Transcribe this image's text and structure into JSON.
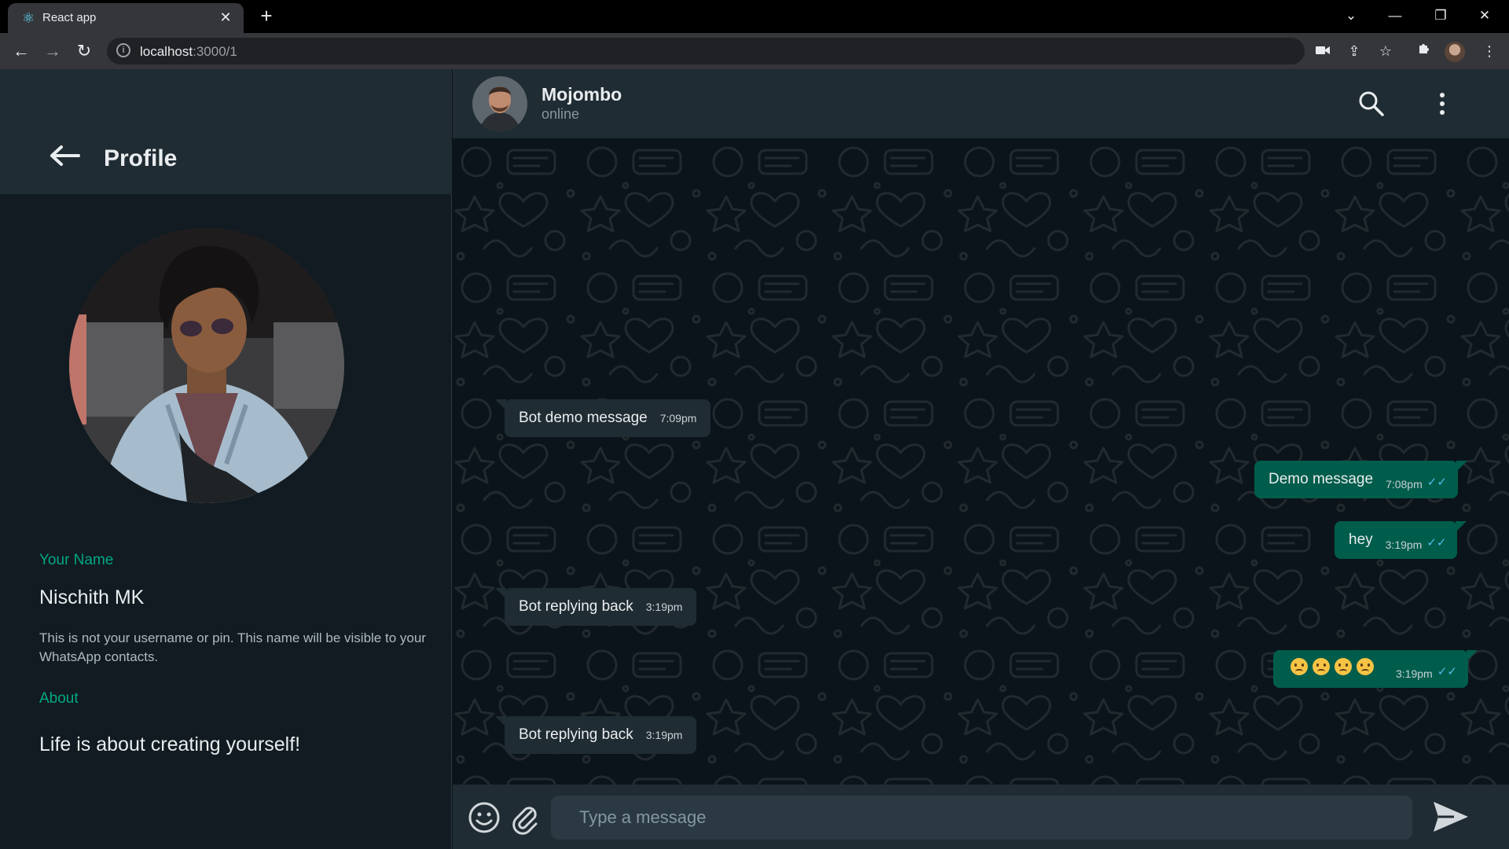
{
  "browser": {
    "tab_title": "React app",
    "url_host": "localhost",
    "url_path": ":3000/1"
  },
  "profile": {
    "title": "Profile",
    "name_label": "Your Name",
    "name_value": "Nischith MK",
    "name_hint": "This is not your username or pin. This name will be visible to your WhatsApp contacts.",
    "about_label": "About",
    "about_value": "Life is about creating yourself!"
  },
  "chat": {
    "contact_name": "Mojombo",
    "contact_status": "online",
    "input_placeholder": "Type a message",
    "messages": [
      {
        "direction": "incoming",
        "text": "Bot demo message",
        "time": "7:09pm"
      },
      {
        "direction": "outgoing",
        "text": "Demo message",
        "time": "7:08pm",
        "ticks": "✓✓"
      },
      {
        "direction": "outgoing",
        "text": "hey",
        "time": "3:19pm",
        "ticks": "✓✓"
      },
      {
        "direction": "incoming",
        "text": "Bot replying back",
        "time": "3:19pm"
      },
      {
        "direction": "outgoing",
        "text": "",
        "emoji_count": 4,
        "time": "3:19pm",
        "ticks": "✓✓"
      },
      {
        "direction": "incoming",
        "text": "Bot replying back",
        "time": "3:19pm"
      }
    ]
  },
  "colors": {
    "accent_green": "#00a884",
    "outgoing_bubble": "#005c4b",
    "incoming_bubble": "#202c33",
    "panel_bg": "#111b21",
    "header_bg": "#202c33",
    "read_ticks": "#53bdeb"
  },
  "icons": [
    "react-favicon",
    "back-arrow-icon",
    "search-icon",
    "menu-dots-icon",
    "emoji-icon",
    "attach-icon",
    "send-icon"
  ]
}
